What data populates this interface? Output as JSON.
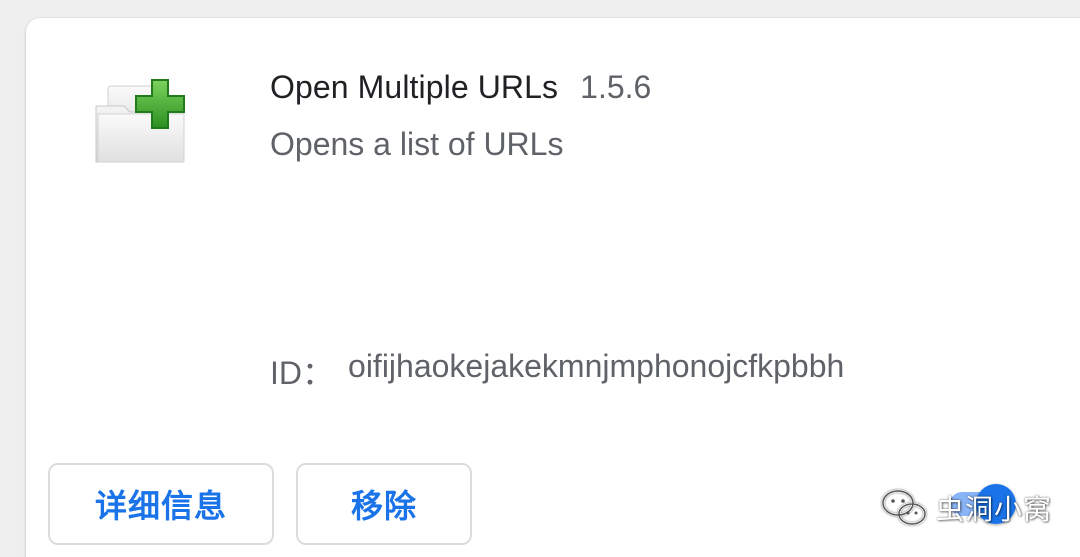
{
  "extension": {
    "name": "Open Multiple URLs",
    "version": "1.5.6",
    "description": "Opens a list of URLs",
    "id_label": "ID：",
    "id_value": "oifijhaokejakekmnjmphonojcfkpbbh",
    "icon": "folder-plus-icon",
    "enabled": true
  },
  "buttons": {
    "details_label": "详细信息",
    "remove_label": "移除"
  },
  "watermark": {
    "text": "虫洞小窝",
    "icon": "wechat-icon"
  },
  "colors": {
    "accent": "#1a73e8",
    "toggle_track": "#8ab4f8",
    "primary_text": "#202124",
    "secondary_text": "#5f6368",
    "icon_plus": "#3aa32b"
  }
}
